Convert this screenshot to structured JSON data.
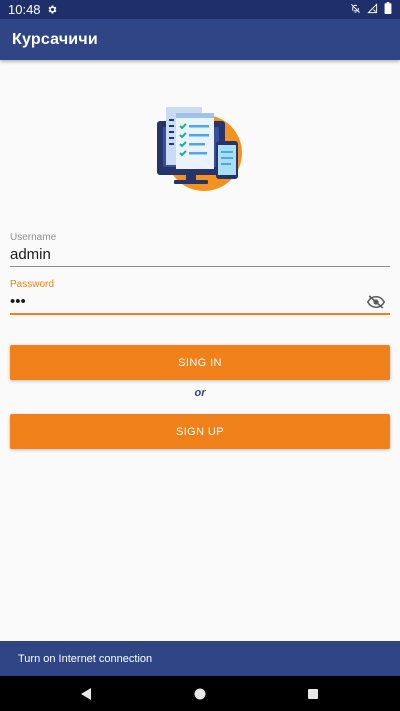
{
  "status_bar": {
    "time": "10:48",
    "left_icons": [
      "gear-icon"
    ],
    "right_icons": [
      "notifications-off-icon",
      "signal-icon",
      "battery-icon"
    ]
  },
  "app_bar": {
    "title": "Курсачичи"
  },
  "illustration": {
    "icon": "survey-monitor-illustration"
  },
  "form": {
    "username": {
      "label": "Username",
      "value": "admin"
    },
    "password": {
      "label": "Password",
      "value": "•••",
      "toggle_icon": "eye-off-icon"
    }
  },
  "buttons": {
    "sign_in": "SING IN",
    "or": "or",
    "sign_up": "SIGN UP"
  },
  "snackbar": {
    "message": "Turn on Internet connection"
  },
  "nav_bar": {
    "icons": [
      "back-icon",
      "home-icon",
      "recents-icon"
    ]
  },
  "colors": {
    "primary": "#2f4585",
    "status_bar": "#1e2f6b",
    "accent": "#f0801a",
    "background": "#fafafa"
  }
}
